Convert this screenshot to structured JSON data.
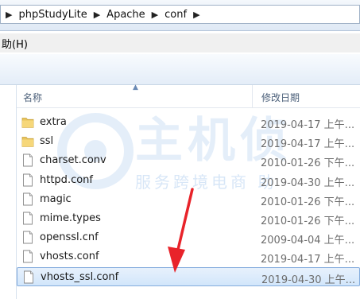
{
  "breadcrumb": {
    "items": [
      "phpStudyLite",
      "Apache",
      "conf"
    ]
  },
  "menubar": {
    "help_label": "助(H)"
  },
  "columns": {
    "name": "名称",
    "date": "修改日期"
  },
  "files": [
    {
      "name": "extra",
      "date": "2019-04-17 上午...",
      "icon": "folder-icon"
    },
    {
      "name": "ssl",
      "date": "2019-04-17 上午...",
      "icon": "folder-icon"
    },
    {
      "name": "charset.conv",
      "date": "2010-01-26 下午...",
      "icon": "file-icon"
    },
    {
      "name": "httpd.conf",
      "date": "2019-04-30 上午...",
      "icon": "file-icon"
    },
    {
      "name": "magic",
      "date": "2010-01-26 下午...",
      "icon": "file-icon"
    },
    {
      "name": "mime.types",
      "date": "2010-01-26 下午...",
      "icon": "file-icon"
    },
    {
      "name": "openssl.cnf",
      "date": "2009-04-04 上午...",
      "icon": "file-icon"
    },
    {
      "name": "vhosts.conf",
      "date": "2019-04-17 上午...",
      "icon": "file-icon"
    },
    {
      "name": "vhosts_ssl.conf",
      "date": "2019-04-30 上午...",
      "icon": "file-icon",
      "selected": true
    }
  ],
  "watermark": {
    "big": "主机侦",
    "small": "服务跨境电商 助"
  },
  "colors": {
    "accent": "#3399ff",
    "arrow": "#e8232a"
  }
}
